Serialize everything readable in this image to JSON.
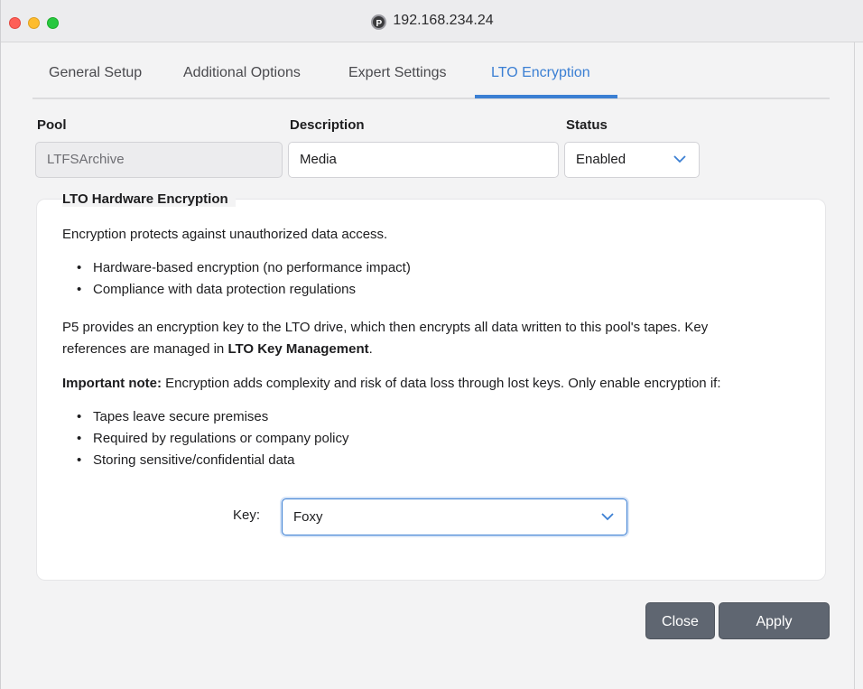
{
  "window": {
    "title": "192.168.234.24",
    "site_icon_glyph": "P"
  },
  "tabs": [
    {
      "label": "General Setup"
    },
    {
      "label": "Additional Options"
    },
    {
      "label": "Expert Settings"
    },
    {
      "label": "LTO Encryption",
      "active": true
    }
  ],
  "form": {
    "pool": {
      "label": "Pool",
      "value": "LTFSArchive"
    },
    "description": {
      "label": "Description",
      "value": "Media"
    },
    "status": {
      "label": "Status",
      "value": "Enabled"
    }
  },
  "encryption": {
    "section_title": "LTO Hardware Encryption",
    "intro": "Encryption protects against unauthorized data access.",
    "benefits": [
      "Hardware-based encryption (no performance impact)",
      "Compliance with data protection regulations"
    ],
    "desc_line1": "P5 provides an encryption key to the LTO drive, which then encrypts all data written to this pool's tapes. Key",
    "desc_line2_prefix": "references are managed in ",
    "desc_link": "LTO Key Management",
    "desc_line2_suffix": ".",
    "note_label": "Important note:",
    "note_text": " Encryption adds complexity and risk of data loss through lost keys. Only enable encryption if:",
    "conditions": [
      "Tapes leave secure premises",
      "Required by regulations or company policy",
      "Storing sensitive/confidential data"
    ],
    "key_label": "Key:",
    "key_value": "Foxy"
  },
  "buttons": {
    "close": "Close",
    "apply": "Apply"
  },
  "colors": {
    "accent": "#3b7fd3",
    "button": "#5f6671"
  }
}
